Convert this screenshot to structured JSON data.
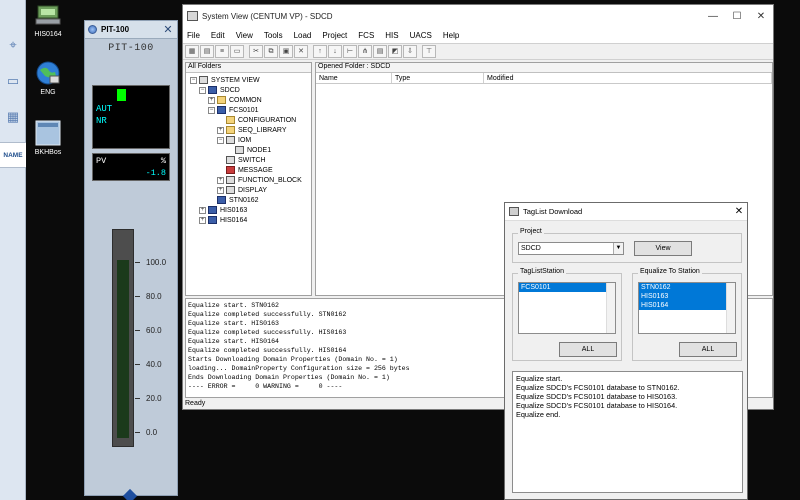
{
  "desktop": {
    "icons": [
      {
        "label": "HIS0164",
        "icon": "station-computer-icon"
      },
      {
        "label": "ENG",
        "icon": "globe-network-icon"
      },
      {
        "label": "BKHBos",
        "icon": "window-app-icon"
      }
    ]
  },
  "taskbar": {
    "name_tab": "NAME"
  },
  "faceplate": {
    "window_title": "PIT-100",
    "close_glyph": "✕",
    "tag": "PIT-100",
    "mode_1": "AUT",
    "mode_2": "NR",
    "pv_label": "PV",
    "pv_unit": "%",
    "pv_value": "-1.8",
    "pv_fraction": 0.0,
    "scale": [
      "100.0",
      "80.0",
      "60.0",
      "40.0",
      "20.0",
      "0.0"
    ],
    "colors": {
      "bar": "#3ea83e",
      "mode_text": "#00ffff",
      "status_lamp": "#00ff00"
    }
  },
  "system_view": {
    "title": "System View (CENTUM VP) - SDCD",
    "window_buttons": [
      "—",
      "☐",
      "✕"
    ],
    "menu": [
      "File",
      "Edit",
      "View",
      "Tools",
      "Load",
      "Project",
      "FCS",
      "HIS",
      "UACS",
      "Help"
    ],
    "tree_header": "All Folders",
    "tree": [
      {
        "label": "SYSTEM VIEW",
        "level": 0,
        "toggle": "-",
        "icon": "system-view-icon"
      },
      {
        "label": "SDCD",
        "level": 1,
        "toggle": "-",
        "icon": "project-icon"
      },
      {
        "label": "COMMON",
        "level": 2,
        "toggle": "+",
        "icon": "folder-icon"
      },
      {
        "label": "FCS0101",
        "level": 2,
        "toggle": "-",
        "icon": "fcs-icon"
      },
      {
        "label": "CONFIGURATION",
        "level": 3,
        "toggle": "",
        "icon": "folder-icon"
      },
      {
        "label": "SEQ_LIBRARY",
        "level": 3,
        "toggle": "+",
        "icon": "folder-icon"
      },
      {
        "label": "IOM",
        "level": 3,
        "toggle": "-",
        "icon": "iom-icon"
      },
      {
        "label": "NODE1",
        "level": 4,
        "toggle": "",
        "icon": "node-icon"
      },
      {
        "label": "SWITCH",
        "level": 3,
        "toggle": "",
        "icon": "switch-icon"
      },
      {
        "label": "MESSAGE",
        "level": 3,
        "toggle": "",
        "icon": "message-icon"
      },
      {
        "label": "FUNCTION_BLOCK",
        "level": 3,
        "toggle": "+",
        "icon": "function-block-icon"
      },
      {
        "label": "DISPLAY",
        "level": 3,
        "toggle": "+",
        "icon": "display-icon"
      },
      {
        "label": "STN0162",
        "level": 2,
        "toggle": "",
        "icon": "station-icon"
      },
      {
        "label": "HIS0163",
        "level": 1,
        "toggle": "+",
        "icon": "station-icon"
      },
      {
        "label": "HIS0164",
        "level": 1,
        "toggle": "+",
        "icon": "station-icon"
      }
    ],
    "list_header": "Opened Folder : SDCD",
    "columns": [
      "Name",
      "Type",
      "Modified"
    ],
    "log": [
      "Equalize start. STN0162",
      "Equalize completed successfully. STN0162",
      "Equalize start. HIS0163",
      "Equalize completed successfully. HIS0163",
      "Equalize start. HIS0164",
      "Equalize completed successfully. HIS0164",
      "Starts Downloading Domain Properties (Domain No. = 1)",
      "loading... DomainProperty Configuration size = 256 bytes",
      "Ends Downloading Domain Properties (Domain No. = 1)",
      "---- ERROR =     0 WARNING =     0 ----"
    ],
    "status": "Ready"
  },
  "taglist_dialog": {
    "title": "TagList Download",
    "close_glyph": "✕",
    "project_label": "Project",
    "project_value": "SDCD",
    "view_button": "View",
    "station_group": "TagListStation",
    "station_items": [
      "FCS0101"
    ],
    "equalize_group": "Equalize To Station",
    "equalize_items": [
      "STN0162",
      "HIS0163",
      "HIS0164"
    ],
    "all_button_left": "ALL",
    "all_button_right": "ALL",
    "messages": [
      "Equalize start.",
      "Equalize SDCD's FCS0101 database to STN0162.",
      "Equalize SDCD's FCS0101 database to HIS0163.",
      "Equalize SDCD's FCS0101 database to HIS0164.",
      "Equalize end."
    ]
  }
}
